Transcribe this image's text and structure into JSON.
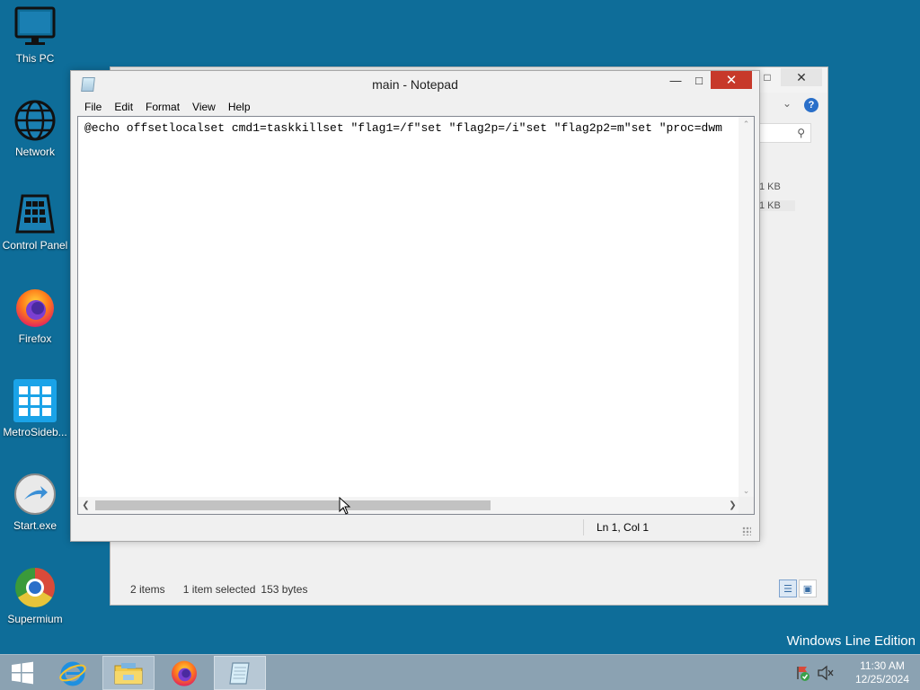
{
  "desktop": {
    "icons": [
      {
        "label": "This PC",
        "icon": "monitor-icon"
      },
      {
        "label": "Network",
        "icon": "globe-icon"
      },
      {
        "label": "Control Panel",
        "icon": "control-panel-icon"
      },
      {
        "label": "Firefox",
        "icon": "firefox-icon"
      },
      {
        "label": "MetroSideb...",
        "icon": "windows-tiles-icon"
      },
      {
        "label": "Start.exe",
        "icon": "start-arrow-icon"
      },
      {
        "label": "Supermium",
        "icon": "supermium-icon"
      }
    ],
    "watermark": "Windows Line Edition"
  },
  "explorer": {
    "files": [
      {
        "size": "1 KB"
      },
      {
        "size": "1 KB"
      }
    ],
    "status": {
      "items": "2 items",
      "selected": "1 item selected",
      "bytes": "153 bytes"
    }
  },
  "notepad": {
    "title": "main - Notepad",
    "menu": [
      "File",
      "Edit",
      "Format",
      "View",
      "Help"
    ],
    "content": "@echo offsetlocalset cmd1=taskkillset \"flag1=/f\"set \"flag2p=/i\"set \"flag2p2=m\"set \"proc=dwm",
    "status": {
      "position": "Ln 1, Col 1"
    }
  },
  "taskbar": {
    "items": [
      {
        "icon": "internet-explorer-icon"
      },
      {
        "icon": "file-explorer-icon"
      },
      {
        "icon": "firefox-icon"
      },
      {
        "icon": "notepad-icon"
      }
    ],
    "tray": {
      "time": "11:30 AM",
      "date": "12/25/2024"
    }
  },
  "colors": {
    "desktop": "#0e6d99",
    "taskbar": "#8ba2b2",
    "close_button": "#c7392a"
  }
}
